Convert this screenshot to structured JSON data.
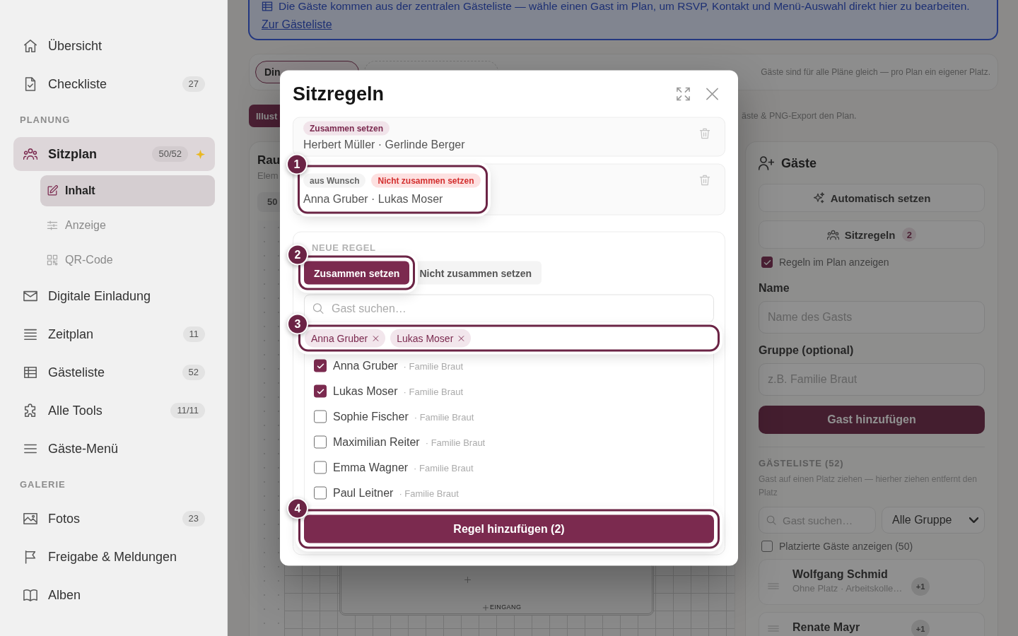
{
  "sidebar": {
    "groups": [
      {
        "items": [
          {
            "label": "Übersicht",
            "selected": false
          },
          {
            "label": "Checkliste",
            "badge": "27",
            "selected": false
          }
        ]
      },
      {
        "title": "PLANUNG",
        "items": [
          {
            "label": "Sitzplan",
            "badge": "50/52",
            "starred": true,
            "selected": true,
            "children": [
              {
                "label": "Inhalt",
                "selected": true
              },
              {
                "label": "Anzeige",
                "selected": false
              },
              {
                "label": "QR-Code",
                "selected": false
              }
            ]
          },
          {
            "label": "Digitale Einladung",
            "selected": false
          },
          {
            "label": "Zeitplan",
            "badge": "11",
            "selected": false
          },
          {
            "label": "Gästeliste",
            "badge": "52",
            "selected": false
          },
          {
            "label": "Alle Tools",
            "badge": "11/11",
            "selected": false
          },
          {
            "label": "Gäste-Menü",
            "selected": false
          }
        ]
      },
      {
        "title": "GALERIE",
        "items": [
          {
            "label": "Fotos",
            "badge": "23",
            "selected": false
          },
          {
            "label": "Freigabe & Meldungen",
            "selected": false
          },
          {
            "label": "Alben",
            "selected": false
          }
        ]
      }
    ]
  },
  "banner": {
    "text": "Die Gäste kommen aus der zentralen Gästeliste — wähle einen Gast im Plan, um RSVP, Kontakt und Menü-Auswahl direkt hier zu bearbeiten.",
    "link": "Zur Gästeliste"
  },
  "plan_tabs": {
    "tabs": [
      {
        "label": "Din",
        "selected": true
      }
    ],
    "add_tab": true,
    "hint": "Gäste sind für alle Pläne gleich — pro Plan ein eigener Platz."
  },
  "export_row": {
    "button": "Illust",
    "hint": "äste & PNG-Export den Plan."
  },
  "plan_card": {
    "title": "Rau",
    "subtitle": "Elem",
    "zoom": "50",
    "entrance": "EINGANG"
  },
  "guest_panel": {
    "title": "Gäste",
    "auto_button": "Automatisch setzen",
    "rules_button": {
      "label": "Sitzregeln",
      "count": "2"
    },
    "show_rules": {
      "label": "Regeln im Plan anzeigen",
      "checked": true
    },
    "fields": [
      {
        "label": "Name",
        "placeholder": "Name des Gasts"
      },
      {
        "label": "Gruppe (optional)",
        "placeholder": "z.B. Familie Braut"
      }
    ],
    "add_button": "Gast hinzufügen",
    "list": {
      "heading": "GÄSTELISTE (52)",
      "hint": "Gast auf einen Platz ziehen — hierher ziehen entfernt den Platz",
      "search": {
        "placeholder": "Gast suchen…"
      },
      "group_filter": "Alle Gruppe",
      "show_placed": {
        "label": "Platzierte Gäste anzeigen (50)",
        "checked": false
      },
      "guests": [
        {
          "name": "Wolfgang Schmid",
          "detail": "Ohne Platz · Arbeitskolle…",
          "plus": "+1"
        },
        {
          "name": "Renate Mayr",
          "plus": "+1"
        }
      ]
    }
  },
  "modal": {
    "title": "Sitzregeln",
    "rules": [
      {
        "tags": [
          {
            "kind": "together",
            "label": "Zusammen setzen"
          }
        ],
        "names": "Herbert Müller · Gerlinde Berger"
      },
      {
        "step": "1",
        "tags": [
          {
            "kind": "source",
            "label": "aus Wunsch"
          },
          {
            "kind": "apart",
            "label": "Nicht zusammen setzen"
          }
        ],
        "names": "Anna Gruber · Lukas Moser"
      }
    ],
    "new_rule": {
      "heading": "NEUE REGEL",
      "types": [
        {
          "label": "Zusammen setzen",
          "selected": true,
          "step": "2"
        },
        {
          "label": "Nicht zusammen setzen",
          "selected": false
        }
      ],
      "search": {
        "placeholder": "Gast suchen…"
      },
      "chips": {
        "step": "3",
        "items": [
          "Anna Gruber",
          "Lukas Moser"
        ]
      },
      "guests": [
        {
          "name": "Anna Gruber",
          "group": "· Familie Braut",
          "checked": true
        },
        {
          "name": "Lukas Moser",
          "group": "· Familie Braut",
          "checked": true
        },
        {
          "name": "Sophie Fischer",
          "group": "· Familie Braut",
          "checked": false
        },
        {
          "name": "Maximilian Reiter",
          "group": "· Familie Braut",
          "checked": false
        },
        {
          "name": "Emma Wagner",
          "group": "· Familie Braut",
          "checked": false
        },
        {
          "name": "Paul Leitner",
          "group": "· Familie Braut",
          "checked": false
        }
      ],
      "submit": {
        "label": "Regel hinzufügen (2)",
        "step": "4"
      }
    }
  }
}
